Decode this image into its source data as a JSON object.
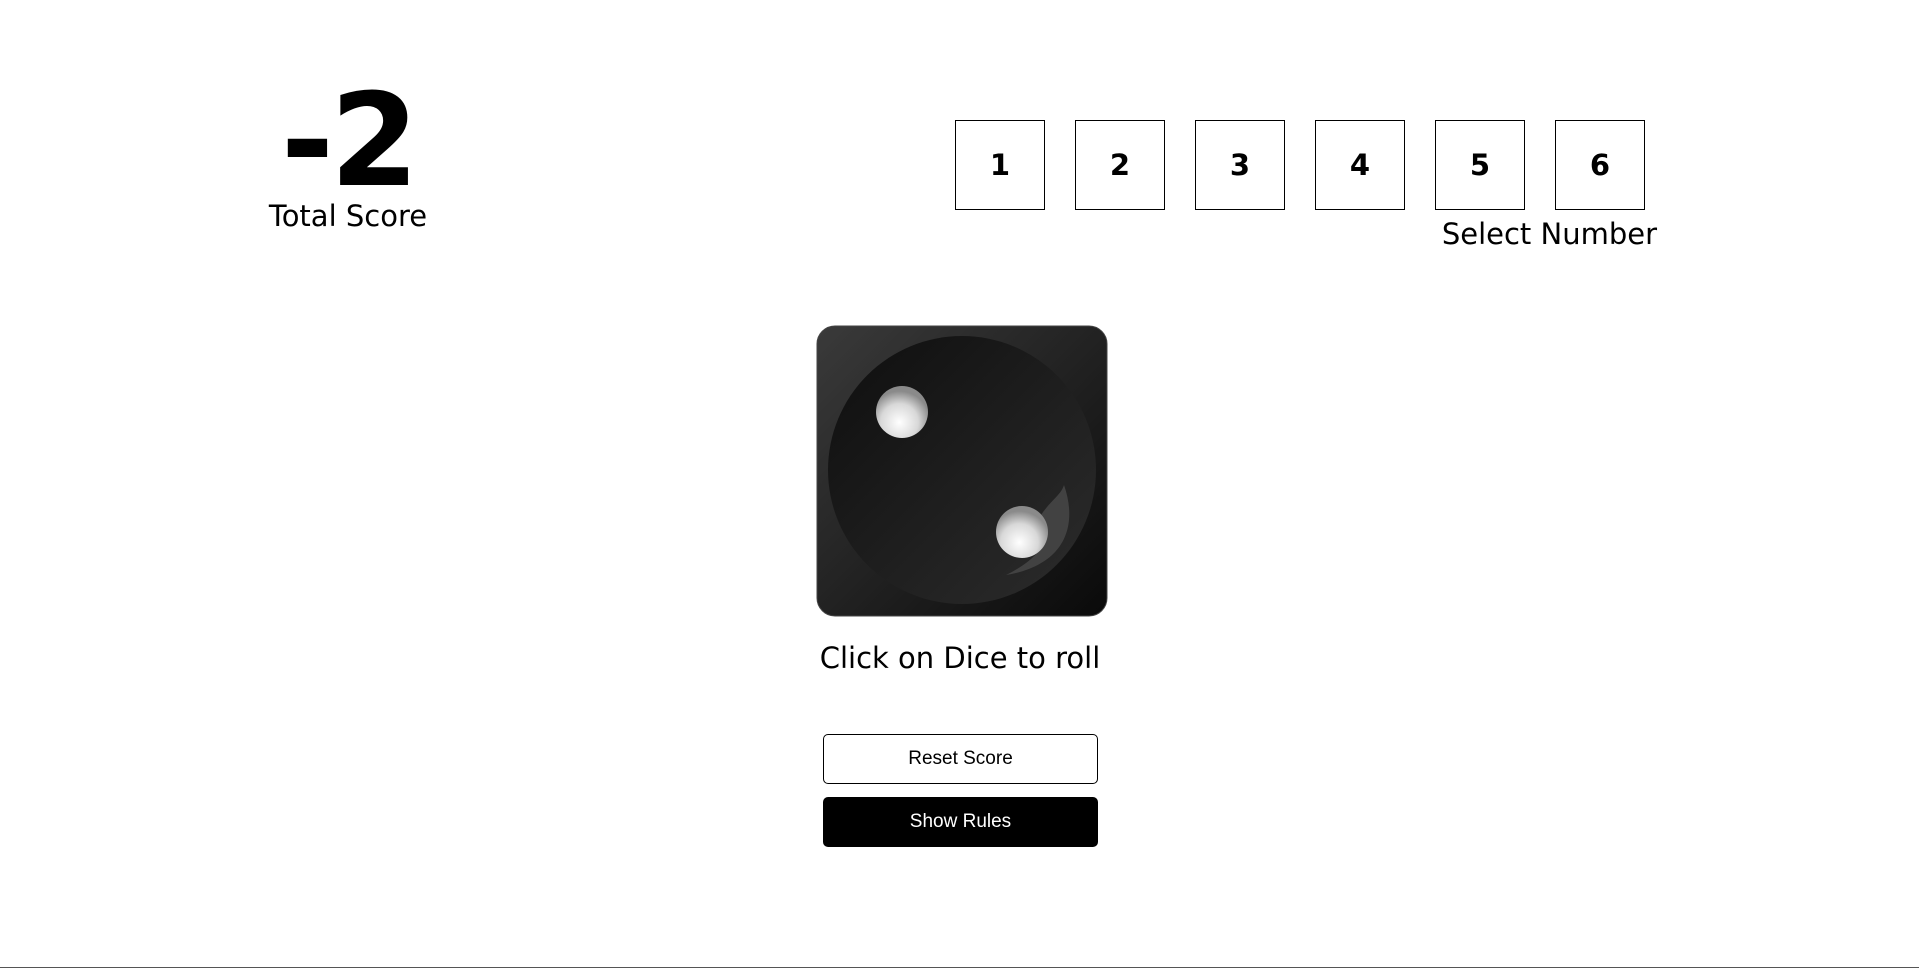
{
  "score": {
    "value": "-2",
    "label": "Total Score"
  },
  "numbers": {
    "options": [
      "1",
      "2",
      "3",
      "4",
      "5",
      "6"
    ],
    "label": "Select Number"
  },
  "dice": {
    "face_value": 2,
    "icon": "dice-two-icon",
    "caption": "Click on Dice to roll"
  },
  "buttons": {
    "reset_label": "Reset Score",
    "rules_label": "Show Rules"
  },
  "colors": {
    "primary": "#000000",
    "background": "#ffffff",
    "dice_body": "#1c1c1c",
    "dice_pip": "#e8e8e8"
  }
}
